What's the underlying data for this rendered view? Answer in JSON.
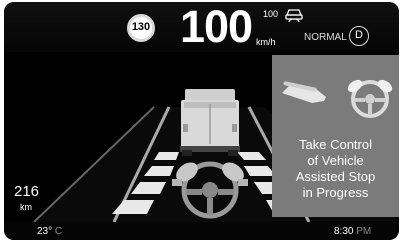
{
  "speed_display": {
    "speed_limit": "130",
    "current_speed": "100",
    "speed_unit": "km/h",
    "set_speed": "100",
    "drive_mode": "NORMAL",
    "gear": "D"
  },
  "odometer": {
    "value": "216",
    "unit": "km"
  },
  "alert": {
    "line1": "Take Control",
    "line2": "of Vehicle",
    "line3": "Assisted Stop",
    "line4": "in Progress"
  },
  "status": {
    "temperature": "23°",
    "temperature_unit": "C",
    "time": "8:30",
    "time_period": "PM"
  },
  "icons": {
    "set_speed": "adaptive-cruise-icon",
    "alert_pedal": "pedal-icon",
    "alert_wheel": "hands-on-wheel-icon",
    "scene_wheel": "hands-on-wheel-icon"
  },
  "colors": {
    "background": "#000000",
    "alert_panel": "#7b7b7b",
    "text": "#ffffff"
  }
}
